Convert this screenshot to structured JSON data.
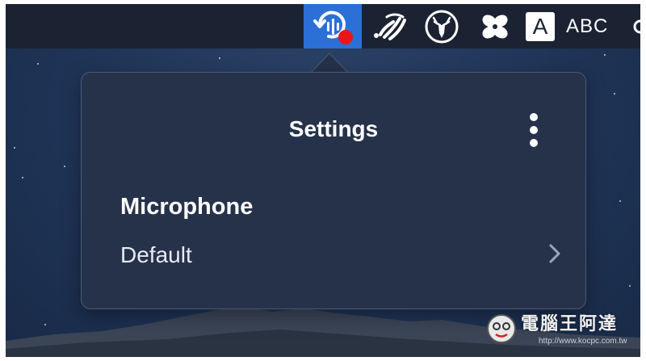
{
  "menubar": {
    "items": [
      {
        "name": "recorder-app-icon",
        "active": true
      },
      {
        "name": "audio-waves-icon"
      },
      {
        "name": "deer-app-icon"
      },
      {
        "name": "pinwheel-app-icon"
      },
      {
        "name": "input-source-icon",
        "label": "A"
      }
    ],
    "input_source_text": "ABC",
    "recording_indicator_color": "#e8161b",
    "active_color": "#2c6fd7"
  },
  "popover": {
    "title": "Settings",
    "more_icon": "vertical-ellipsis-icon",
    "sections": [
      {
        "label": "Microphone",
        "value": "Default",
        "icon": "chevron-right-icon"
      }
    ]
  },
  "watermark": {
    "text": "電腦王阿達",
    "url": "http://www.kocpc.com.tw"
  }
}
